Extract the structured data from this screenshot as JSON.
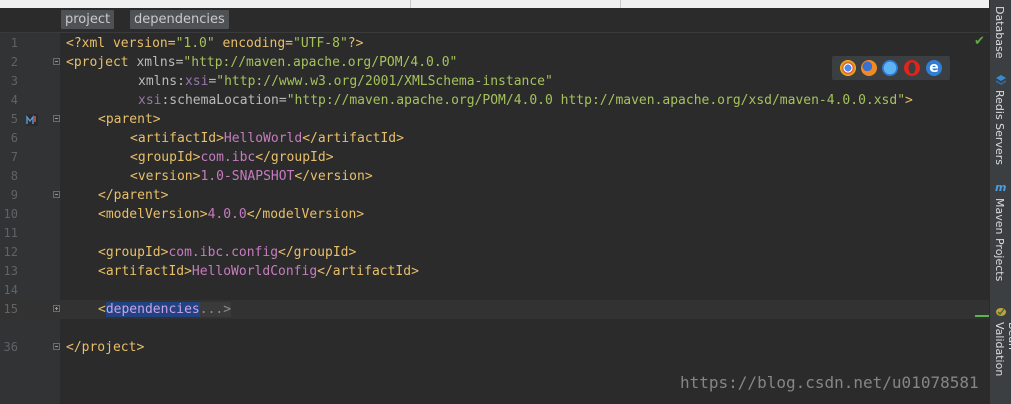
{
  "breadcrumbs": [
    "project",
    "dependencies"
  ],
  "lines": [
    {
      "n": "1"
    },
    {
      "n": "2"
    },
    {
      "n": "3"
    },
    {
      "n": "4"
    },
    {
      "n": "5"
    },
    {
      "n": "6"
    },
    {
      "n": "7"
    },
    {
      "n": "8"
    },
    {
      "n": "9"
    },
    {
      "n": "10"
    },
    {
      "n": "11"
    },
    {
      "n": "12"
    },
    {
      "n": "13"
    },
    {
      "n": "14"
    },
    {
      "n": "15"
    },
    {
      "n": "36"
    }
  ],
  "code": {
    "l1_a": "<?xml version=",
    "l1_b": "\"1.0\"",
    "l1_c": " encoding=",
    "l1_d": "\"UTF-8\"",
    "l1_e": "?>",
    "l2_a": "<project",
    "l2_b": " xmlns=",
    "l2_c": "\"http://maven.apache.org/POM/4.0.0\"",
    "l3_a": "xmlns",
    "l3_b": ":",
    "l3_c": "xsi",
    "l3_d": "=",
    "l3_e": "\"http://www.w3.org/2001/XMLSchema-instance\"",
    "l4_a": "xsi",
    "l4_b": ":schemaLocation=",
    "l4_c": "\"http://maven.apache.org/POM/4.0.0 http://maven.apache.org/xsd/maven-4.0.0.xsd\"",
    "l4_d": ">",
    "l5": "<parent>",
    "l6_a": "<artifactId>",
    "l6_b": "HelloWorld",
    "l6_c": "</artifactId>",
    "l7_a": "<groupId>",
    "l7_b": "com.ibc",
    "l7_c": "</groupId>",
    "l8_a": "<version>",
    "l8_b": "1.0-SNAPSHOT",
    "l8_c": "</version>",
    "l9": "</parent>",
    "l10_a": "<modelVersion>",
    "l10_b": "4.0.0",
    "l10_c": "</modelVersion>",
    "l12_a": "<groupId>",
    "l12_b": "com.ibc.config",
    "l12_c": "</groupId>",
    "l13_a": "<artifactId>",
    "l13_b": "HelloWorldConfig",
    "l13_c": "</artifactId>",
    "l15_a": "<",
    "l15_b": "dependencies",
    "l15_c": "...>",
    "l36": "</project>"
  },
  "right_tabs": [
    "Database",
    "Redis Servers",
    "Maven Projects",
    "Bean Validation"
  ],
  "watermark": "https://blog.csdn.net/u01078581",
  "colors": {
    "tag": "#e8bf6a",
    "string": "#a5c25c",
    "text": "#c57cbf",
    "namespace": "#9876aa",
    "selection": "#214283"
  }
}
